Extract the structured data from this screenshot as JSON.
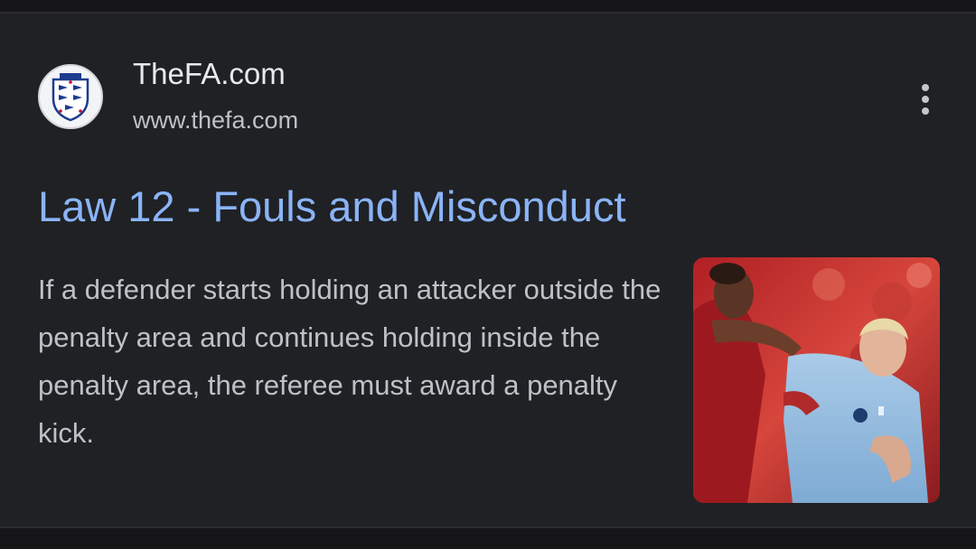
{
  "result": {
    "site_name": "TheFA.com",
    "site_url": "www.thefa.com",
    "title": "Law 12 - Fouls and Misconduct",
    "snippet": "If a defender starts holding an attacker outside the penalty area and continues holding inside the penalty area, the referee must award a penalty kick.",
    "favicon_icon": "england-fa-crest-icon",
    "more_icon": "more-vert-icon",
    "thumbnail": "football-players-photo"
  },
  "colors": {
    "page_background": "#161618",
    "card_background": "#202124",
    "title_link": "#8ab4f8",
    "primary_text": "#e8eaed",
    "secondary_text": "#bdc1c6"
  }
}
